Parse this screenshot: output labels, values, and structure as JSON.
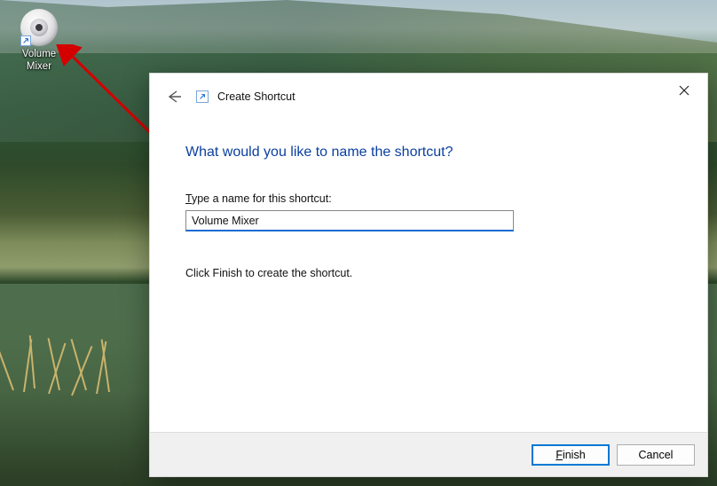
{
  "desktop": {
    "shortcut": {
      "icon_name": "volume-speaker-icon",
      "label_line1": "Volume",
      "label_line2": "Mixer"
    }
  },
  "dialog": {
    "title": "Create Shortcut",
    "heading": "What would you like to name the shortcut?",
    "field_label_prefix": "T",
    "field_label_rest": "ype a name for this shortcut:",
    "input_value": "Volume Mixer",
    "help_text": "Click Finish to create the shortcut.",
    "finish_prefix": "F",
    "finish_rest": "inish",
    "cancel_label": "Cancel"
  }
}
